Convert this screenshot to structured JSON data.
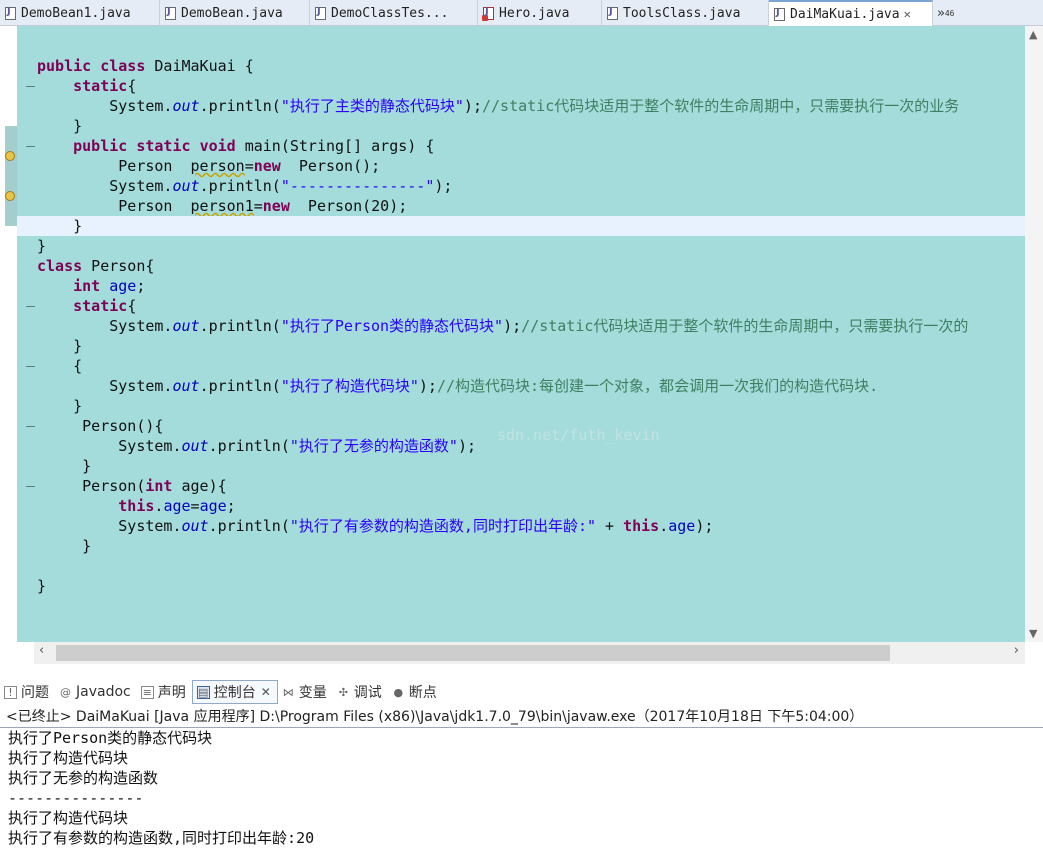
{
  "editor_tabs": [
    {
      "label": "DemoBean1.java",
      "error": false
    },
    {
      "label": "DemoBean.java",
      "error": false
    },
    {
      "label": "DemoClassTes...",
      "error": false
    },
    {
      "label": "Hero.java",
      "error": true
    },
    {
      "label": "ToolsClass.java",
      "error": false
    },
    {
      "label": "DaiMaKuai.java",
      "error": false,
      "active": true,
      "close": "✕"
    }
  ],
  "overflow_tab": {
    "chevron": "»",
    "count": "46"
  },
  "code_lines": [
    {
      "text": ""
    },
    {
      "text": "public class DaiMaKuai {",
      "kind": "classdecl"
    },
    {
      "text": "    static{",
      "fold": true
    },
    {
      "text": "        System.out.println(\"执行了主类的静态代码块\");//static代码块适用于整个软件的生命周期中，只需要执行一次的业务"
    },
    {
      "text": "    }"
    },
    {
      "text": "    public static void main(String[] args) {",
      "fold": true
    },
    {
      "text": "         Person  person=new  Person();"
    },
    {
      "text": "        System.out.println(\"---------------\");"
    },
    {
      "text": "         Person  person1=new  Person(20);"
    },
    {
      "text": "    }",
      "current": true
    },
    {
      "text": "}"
    },
    {
      "text": "class Person{"
    },
    {
      "text": "    int age;"
    },
    {
      "text": "    static{",
      "fold": true
    },
    {
      "text": "        System.out.println(\"执行了Person类的静态代码块\");//static代码块适用于整个软件的生命周期中，只需要执行一次的"
    },
    {
      "text": "    }"
    },
    {
      "text": "    {",
      "fold": true
    },
    {
      "text": "        System.out.println(\"执行了构造代码块\");//构造代码块:每创建一个对象，都会调用一次我们的构造代码块."
    },
    {
      "text": "    }"
    },
    {
      "text": "     Person(){",
      "fold": true
    },
    {
      "text": "         System.out.println(\"执行了无参的构造函数\");"
    },
    {
      "text": "     }"
    },
    {
      "text": "     Person(int age){",
      "fold": true
    },
    {
      "text": "         this.age=age;"
    },
    {
      "text": "         System.out.println(\"执行了有参数的构造函数,同时打印出年龄:\" + this.age);"
    },
    {
      "text": "     }"
    },
    {
      "text": ""
    },
    {
      "text": "}"
    }
  ],
  "watermark": "sdn.net/futh_kevin",
  "view_tabs": [
    {
      "label": "问题",
      "icon": "problems-icon"
    },
    {
      "label": "Javadoc",
      "icon": "javadoc-icon"
    },
    {
      "label": "声明",
      "icon": "declaration-icon"
    },
    {
      "label": "控制台",
      "icon": "console-icon",
      "active": true,
      "close": "✕"
    },
    {
      "label": "变量",
      "icon": "variables-icon"
    },
    {
      "label": "调试",
      "icon": "debug-icon"
    },
    {
      "label": "断点",
      "icon": "breakpoints-icon"
    }
  ],
  "console": {
    "header": "<已终止> DaiMaKuai [Java 应用程序] D:\\Program Files (x86)\\Java\\jdk1.7.0_79\\bin\\javaw.exe（2017年10月18日 下午5:04:00）",
    "lines": [
      "执行了Person类的静态代码块",
      "执行了构造代码块",
      "执行了无参的构造函数",
      "---------------",
      "执行了构造代码块",
      "执行了有参数的构造函数,同时打印出年龄:20"
    ]
  },
  "colors": {
    "editor_bg": "#a4dcdc",
    "keyword": "#7f0055",
    "string": "#2a00ff",
    "comment": "#3f7f5f",
    "field": "#0000c0"
  }
}
